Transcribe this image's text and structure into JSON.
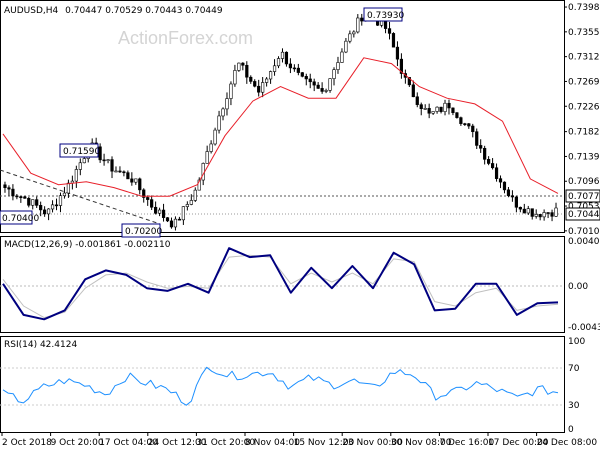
{
  "header": {
    "symbol": "AUDUSD,H4",
    "ohlc": "0.70447 0.70529 0.70443 0.70449",
    "watermark": "ActionForex.com"
  },
  "panels": {
    "macd_label": "MACD(12,26,9) -0.001861 -0.002110",
    "rsi_label": "RSI(14) 42.4124"
  },
  "colors": {
    "candles": "#000000",
    "sma": "#e8202a",
    "macd_line": "#000080",
    "macd_signal": "#c0c0c0",
    "rsi_line": "#1e90ff",
    "grid": "#c8c8c8",
    "dotted_level": "#555555"
  },
  "chart_data": [
    {
      "type": "candlestick",
      "title": "AUDUSD,H4",
      "x": [
        "2 Oct 2018",
        "9 Oct 20:00",
        "17 Oct 04:00",
        "24 Oct 12:00",
        "31 Oct 20:00",
        "8 Nov 04:00",
        "15 Nov 12:00",
        "23 Nov 00:00",
        "30 Nov 08:00",
        "7 Dec 16:00",
        "17 Dec 00:00",
        "24 Dec 08:00"
      ],
      "y_ticks": [
        "0.73980",
        "0.73550",
        "0.73120",
        "0.72690",
        "0.72260",
        "0.71820",
        "0.71390",
        "0.70960",
        "0.70530",
        "0.70100"
      ],
      "ylim": [
        0.7008,
        0.7405
      ],
      "annotations": [
        "0.73930",
        "0.71590",
        "0.70400",
        "0.70200"
      ],
      "level_labels": [
        "0.70770",
        "0.70449"
      ],
      "key_closes": [
        0.7085,
        0.7065,
        0.704,
        0.709,
        0.7159,
        0.712,
        0.71,
        0.705,
        0.702,
        0.708,
        0.72,
        0.73,
        0.725,
        0.732,
        0.727,
        0.725,
        0.733,
        0.7393,
        0.736,
        0.726,
        0.721,
        0.723,
        0.718,
        0.712,
        0.706,
        0.704,
        0.7045
      ],
      "series": [
        {
          "name": "SMA",
          "values": [
            0.7178,
            0.711,
            0.709,
            0.7095,
            0.7085,
            0.707,
            0.707,
            0.709,
            0.7175,
            0.7235,
            0.726,
            0.724,
            0.724,
            0.731,
            0.73,
            0.726,
            0.724,
            0.723,
            0.72,
            0.71,
            0.7075
          ]
        }
      ]
    },
    {
      "type": "line",
      "title": "MACD(12,26,9) -0.001861 -0.002110",
      "y_ticks": [
        "0.004085",
        "0.00",
        "-0.0043"
      ],
      "ylim": [
        -0.0052,
        0.0047
      ],
      "series": [
        {
          "name": "MACD",
          "values": [
            0.0,
            -0.0035,
            -0.004,
            -0.003,
            0.0005,
            0.0015,
            0.001,
            -0.0005,
            -0.0008,
            0.0,
            -0.001,
            0.004,
            0.003,
            0.0032,
            -0.001,
            0.0018,
            -0.0005,
            0.002,
            -0.0005,
            0.0035,
            0.0022,
            -0.003,
            -0.0028,
            0.0,
            0.0,
            -0.0035,
            -0.0022,
            -0.0021
          ]
        },
        {
          "name": "Signal",
          "values": [
            0.0005,
            -0.0025,
            -0.0038,
            -0.0032,
            -0.0005,
            0.001,
            0.0012,
            0.0002,
            -0.0005,
            -0.0003,
            -0.0005,
            0.003,
            0.0032,
            0.003,
            0.0,
            0.0012,
            0.0002,
            0.0012,
            0.0,
            0.0028,
            0.0025,
            -0.002,
            -0.0025,
            -0.001,
            -0.0005,
            -0.003,
            -0.0025,
            -0.0023
          ]
        }
      ]
    },
    {
      "type": "line",
      "title": "RSI(14) 42.4124",
      "y_ticks": [
        "100",
        "70",
        "30",
        "0"
      ],
      "ylim": [
        0,
        100
      ],
      "series": [
        {
          "name": "RSI",
          "values": [
            40,
            32,
            48,
            55,
            50,
            40,
            60,
            52,
            45,
            30,
            72,
            60,
            62,
            65,
            48,
            58,
            50,
            55,
            45,
            65,
            62,
            38,
            42,
            52,
            45,
            35,
            45,
            42
          ]
        }
      ]
    }
  ]
}
